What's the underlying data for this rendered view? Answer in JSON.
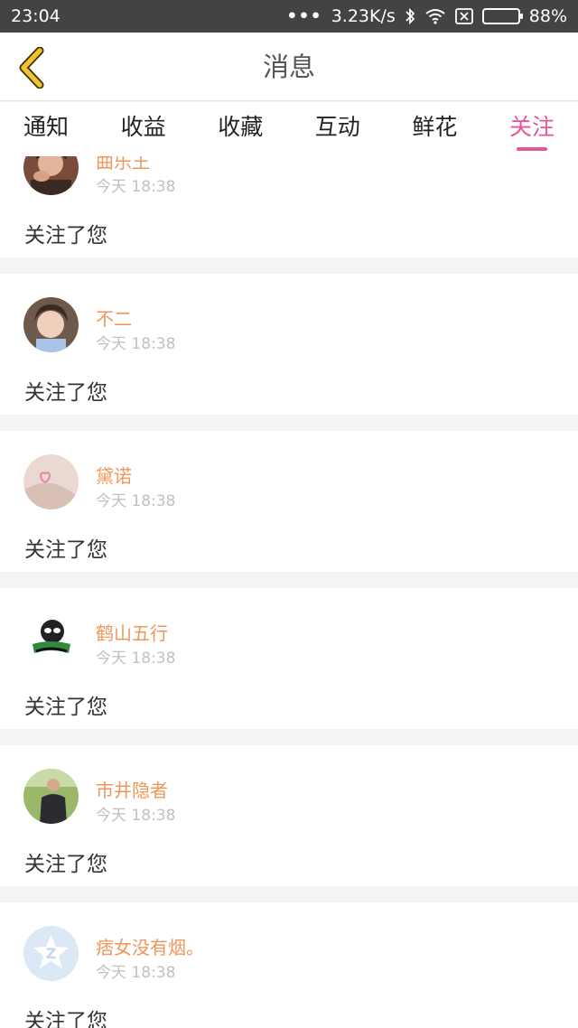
{
  "status_bar": {
    "time": "23:04",
    "dots": "•••",
    "speed": "3.23K/s",
    "battery": "88%",
    "battery_level": 0.88
  },
  "header": {
    "title": "消息",
    "back_icon": "chevron-left-icon"
  },
  "tabs": [
    {
      "label": "通知"
    },
    {
      "label": "收益"
    },
    {
      "label": "收藏"
    },
    {
      "label": "互动"
    },
    {
      "label": "鲜花"
    },
    {
      "label": "关注",
      "active": true
    }
  ],
  "items": [
    {
      "name": "曲乐王",
      "time": "今天 18:38",
      "message": "关注了您",
      "avatar": "man-portrait"
    },
    {
      "name": "不二",
      "time": "今天 18:38",
      "message": "关注了您",
      "avatar": "young-man-portrait"
    },
    {
      "name": "黛诺",
      "time": "今天 18:38",
      "message": "关注了您",
      "avatar": "heart-photo"
    },
    {
      "name": "鹤山五行",
      "time": "今天 18:38",
      "message": "关注了您",
      "avatar": "cartoon-avatar"
    },
    {
      "name": "市井隐者",
      "time": "今天 18:38",
      "message": "关注了您",
      "avatar": "man-outdoor-photo"
    },
    {
      "name": "痞女没有烟。",
      "time": "今天 18:38",
      "message": "关注了您",
      "avatar": "default-avatar"
    }
  ],
  "colors": {
    "accent": "#e5569a",
    "name": "#f0965a",
    "back_icon": "#f2c230"
  }
}
